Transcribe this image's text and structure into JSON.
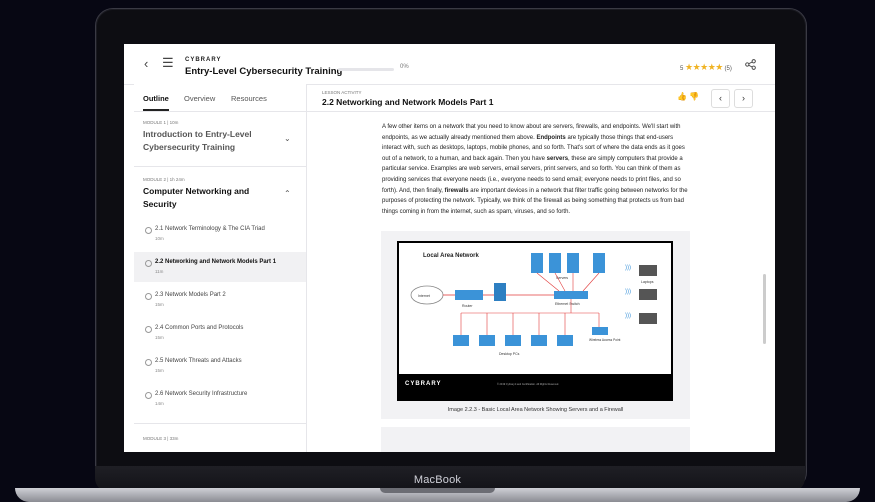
{
  "device": {
    "brand": "MacBook"
  },
  "header": {
    "logo": "CYBRARY",
    "course_title": "Entry-Level Cybersecurity Training",
    "progress_pct": "0%",
    "progress_value": 0,
    "rating_value": "5",
    "rating_count": "(5)",
    "stars": "★★★★★"
  },
  "sidebar": {
    "tabs": [
      "Outline",
      "Overview",
      "Resources"
    ],
    "modules": [
      {
        "meta": "MODULE 1 | 10m",
        "title": "Introduction to Entry-Level Cybersecurity Training"
      },
      {
        "meta": "MODULE 2 | 1h 24m",
        "title": "Computer Networking and Security"
      },
      {
        "meta": "MODULE 3 | 33m"
      }
    ],
    "lessons": [
      {
        "title": "2.1 Network Terminology & The CIA Triad",
        "duration": "10m"
      },
      {
        "title": "2.2 Networking and Network Models Part 1",
        "duration": "11m"
      },
      {
        "title": "2.3 Network Models Part 2",
        "duration": "15m"
      },
      {
        "title": "2.4 Common Ports and Protocols",
        "duration": "15m"
      },
      {
        "title": "2.5 Network Threats and Attacks",
        "duration": "15m"
      },
      {
        "title": "2.6 Network Security Infrastructure",
        "duration": "14m"
      }
    ]
  },
  "lesson": {
    "kicker": "LESSON ACTIVITY",
    "title": "2.2 Networking and Network Models Part 1",
    "paragraph_parts": [
      "A few other items on a network that you need to know about are servers, firewalls, and endpoints. We'll start with endpoints, as we actually already mentioned them above. ",
      "Endpoints",
      " are typically those things that end-users interact with, such as desktops, laptops, mobile phones, and so forth. That's sort of where the data ends as it goes out of a network, to a human, and back again. Then you have ",
      "servers",
      ", these are simply computers that provide a particular service. Examples are web servers, email servers, print servers, and so forth. You can think of them as providing services that everyone needs (i.e., everyone needs to send email; everyone needs to print files, and so forth). And, then finally, ",
      "firewalls",
      " are important devices in a network that filter traffic going between networks for the purposes of protecting the network. Typically, we think of the firewall as being something that protects us from bad things coming in from the internet, such as spam, viruses, and so forth."
    ],
    "figure": {
      "title": "Local Area Network",
      "labels": {
        "internet": "Internet",
        "router": "Router",
        "servers": "Servers",
        "ethernet_switch": "Ethernet Switch",
        "laptops": "Laptops",
        "desktop_pcs": "Desktop PCs",
        "wap": "Wireless Access Point"
      },
      "footer_logo": "CYBRARY",
      "copyright": "© 2019 Cybrary.it and Certification. All Rights Reserved.",
      "caption": "Image 2.2.3 - Basic Local Area Network Showing Servers and a Firewall"
    }
  },
  "colors": {
    "accent_star": "#f0b323",
    "network_blue": "#3b93d8",
    "link_red": "#e23b3b"
  }
}
